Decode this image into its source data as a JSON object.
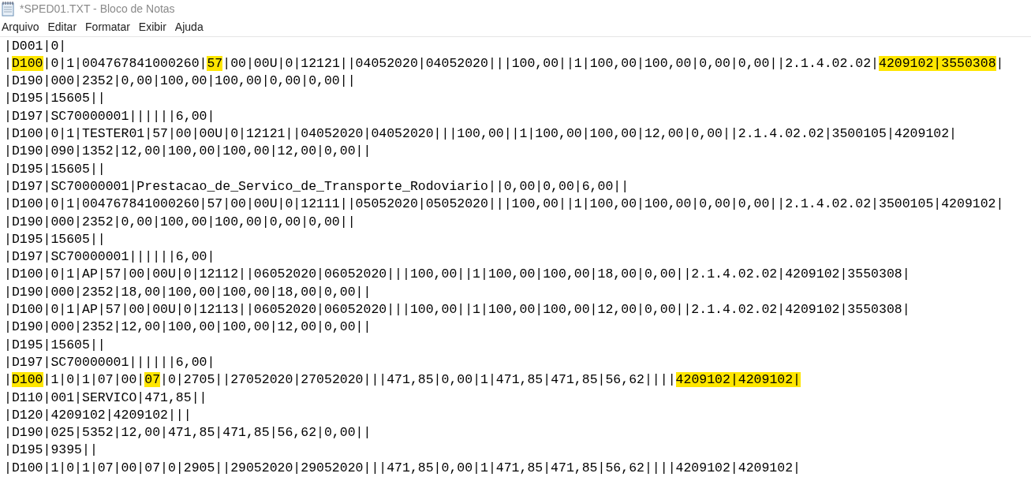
{
  "window": {
    "title": "*SPED01.TXT - Bloco de Notas"
  },
  "menu": [
    {
      "label": "Arquivo"
    },
    {
      "label": "Editar"
    },
    {
      "label": "Formatar"
    },
    {
      "label": "Exibir"
    },
    {
      "label": "Ajuda"
    }
  ],
  "lines": [
    {
      "segments": [
        {
          "text": "|D001|0|",
          "highlighted": false
        }
      ]
    },
    {
      "segments": [
        {
          "text": "|",
          "highlighted": false
        },
        {
          "text": "D100",
          "highlighted": true
        },
        {
          "text": "|0|1|004767841000260|",
          "highlighted": false
        },
        {
          "text": "57",
          "highlighted": true
        },
        {
          "text": "|00|00U|0|12121||04052020|04052020|||100,00||1|100,00|100,00|0,00|0,00||2.1.4.02.02|",
          "highlighted": false
        },
        {
          "text": "4209102|3550308",
          "highlighted": true
        },
        {
          "text": "|",
          "highlighted": false
        }
      ]
    },
    {
      "segments": [
        {
          "text": "|D190|000|2352|0,00|100,00|100,00|0,00|0,00||",
          "highlighted": false
        }
      ]
    },
    {
      "segments": [
        {
          "text": "|D195|15605||",
          "highlighted": false
        }
      ]
    },
    {
      "segments": [
        {
          "text": "|D197|SC70000001||||||6,00|",
          "highlighted": false
        }
      ]
    },
    {
      "segments": [
        {
          "text": "|D100|0|1|TESTER01|57|00|00U|0|12121||04052020|04052020|||100,00||1|100,00|100,00|12,00|0,00||2.1.4.02.02|3500105|4209102|",
          "highlighted": false
        }
      ]
    },
    {
      "segments": [
        {
          "text": "|D190|090|1352|12,00|100,00|100,00|12,00|0,00||",
          "highlighted": false
        }
      ]
    },
    {
      "segments": [
        {
          "text": "|D195|15605||",
          "highlighted": false
        }
      ]
    },
    {
      "segments": [
        {
          "text": "|D197|SC70000001|Prestacao_de_Servico_de_Transporte_Rodoviario||0,00|0,00|6,00||",
          "highlighted": false
        }
      ]
    },
    {
      "segments": [
        {
          "text": "|D100|0|1|004767841000260|57|00|00U|0|12111||05052020|05052020|||100,00||1|100,00|100,00|0,00|0,00||2.1.4.02.02|3500105|4209102|",
          "highlighted": false
        }
      ]
    },
    {
      "segments": [
        {
          "text": "|D190|000|2352|0,00|100,00|100,00|0,00|0,00||",
          "highlighted": false
        }
      ]
    },
    {
      "segments": [
        {
          "text": "|D195|15605||",
          "highlighted": false
        }
      ]
    },
    {
      "segments": [
        {
          "text": "|D197|SC70000001||||||6,00|",
          "highlighted": false
        }
      ]
    },
    {
      "segments": [
        {
          "text": "|D100|0|1|AP|57|00|00U|0|12112||06052020|06052020|||100,00||1|100,00|100,00|18,00|0,00||2.1.4.02.02|4209102|3550308|",
          "highlighted": false
        }
      ]
    },
    {
      "segments": [
        {
          "text": "|D190|000|2352|18,00|100,00|100,00|18,00|0,00||",
          "highlighted": false
        }
      ]
    },
    {
      "segments": [
        {
          "text": "|D100|0|1|AP|57|00|00U|0|12113||06052020|06052020|||100,00||1|100,00|100,00|12,00|0,00||2.1.4.02.02|4209102|3550308|",
          "highlighted": false
        }
      ]
    },
    {
      "segments": [
        {
          "text": "|D190|000|2352|12,00|100,00|100,00|12,00|0,00||",
          "highlighted": false
        }
      ]
    },
    {
      "segments": [
        {
          "text": "|D195|15605||",
          "highlighted": false
        }
      ]
    },
    {
      "segments": [
        {
          "text": "|D197|SC70000001||||||6,00|",
          "highlighted": false
        }
      ]
    },
    {
      "segments": [
        {
          "text": "|",
          "highlighted": false
        },
        {
          "text": "D100",
          "highlighted": true
        },
        {
          "text": "|1|0|1|07|00|",
          "highlighted": false
        },
        {
          "text": "07",
          "highlighted": true
        },
        {
          "text": "|0|2705||27052020|27052020|||471,85|0,00|1|471,85|471,85|56,62||||",
          "highlighted": false
        },
        {
          "text": "4209102|4209102|",
          "highlighted": true
        }
      ]
    },
    {
      "segments": [
        {
          "text": "|D110|001|SERVICO|471,85||",
          "highlighted": false
        }
      ]
    },
    {
      "segments": [
        {
          "text": "|D120|4209102|4209102|||",
          "highlighted": false
        }
      ]
    },
    {
      "segments": [
        {
          "text": "|D190|025|5352|12,00|471,85|471,85|56,62|0,00||",
          "highlighted": false
        }
      ]
    },
    {
      "segments": [
        {
          "text": "|D195|9395||",
          "highlighted": false
        }
      ]
    },
    {
      "segments": [
        {
          "text": "|D100|1|0|1|07|00|07|0|2905||29052020|29052020|||471,85|0,00|1|471,85|471,85|56,62||||4209102|4209102|",
          "highlighted": false
        }
      ]
    }
  ]
}
